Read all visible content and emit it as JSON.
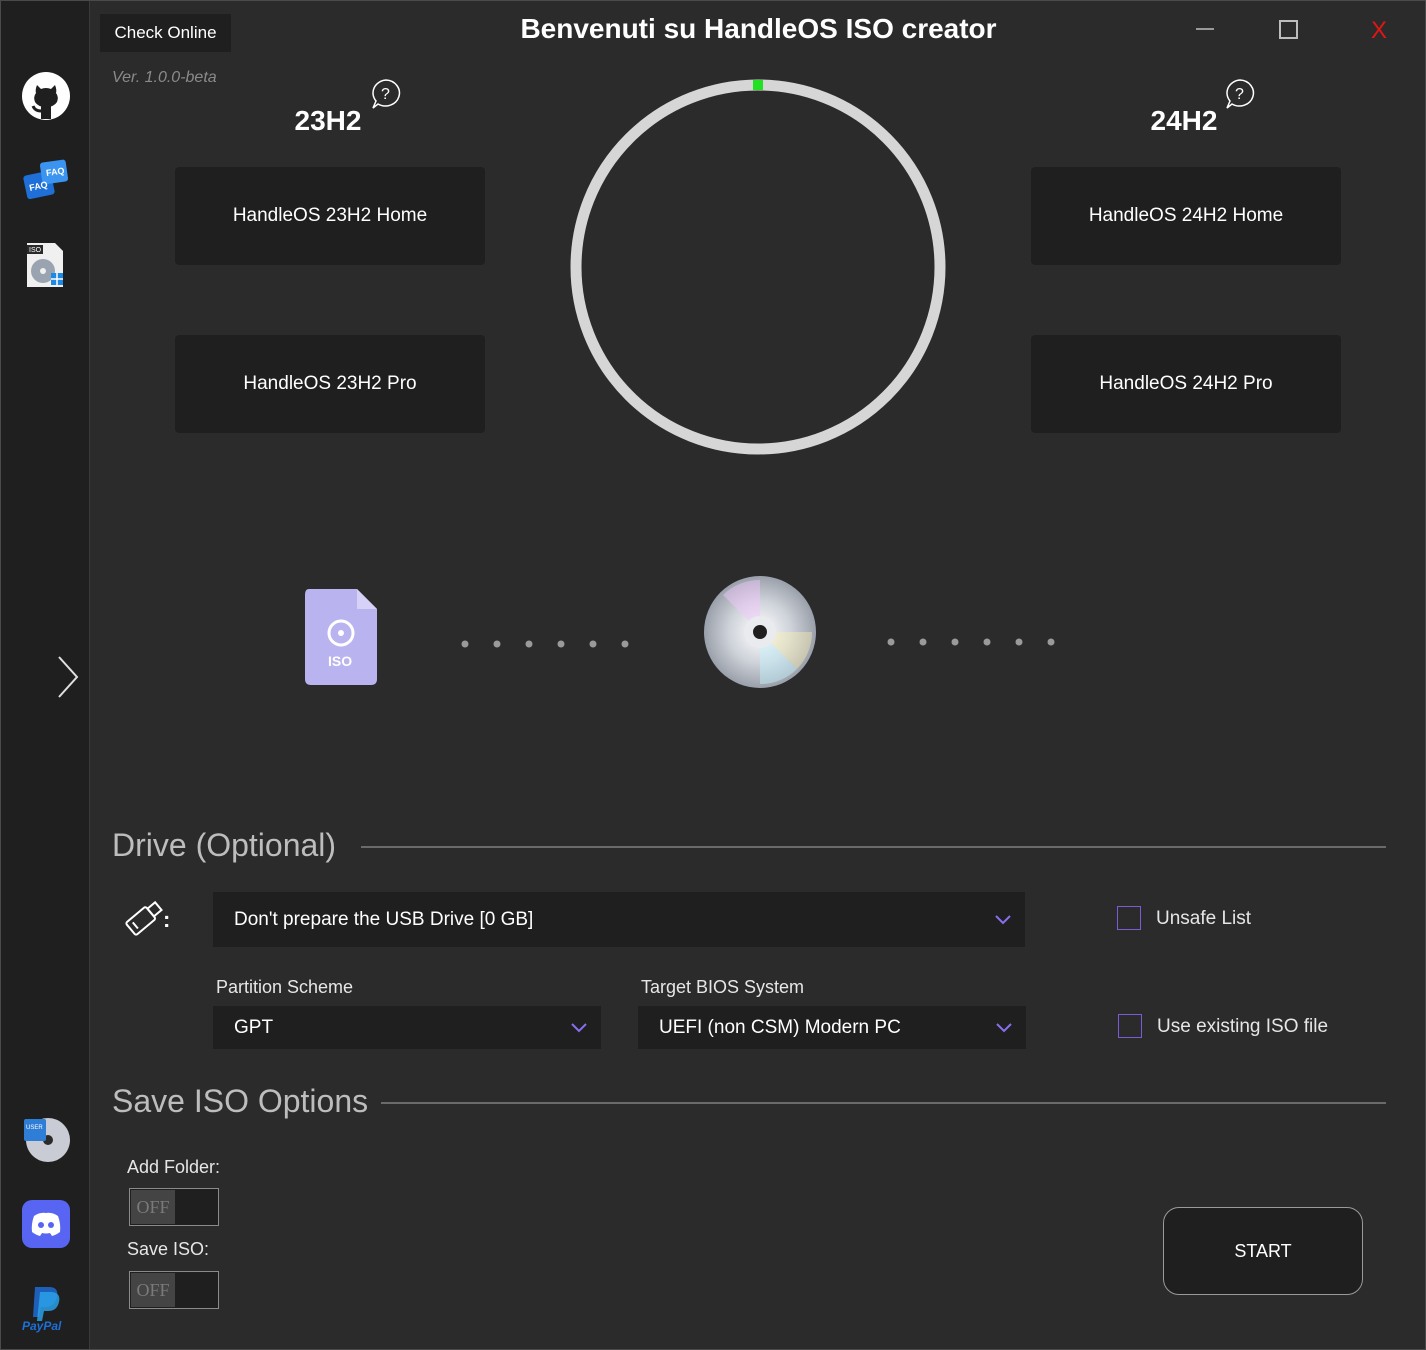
{
  "titlebar": {
    "check_online": "Check Online",
    "version": "Ver. 1.0.0-beta",
    "title": "Benvenuti su HandleOS ISO creator",
    "close_label": "X"
  },
  "sidebar": {
    "items": [
      {
        "name": "github-icon"
      },
      {
        "name": "faq-icon",
        "badge": "FAQ"
      },
      {
        "name": "iso-tool-icon",
        "badge": "ISO"
      },
      {
        "name": "expand-arrow-icon"
      },
      {
        "name": "user-disc-icon",
        "badge": "USER"
      },
      {
        "name": "discord-icon"
      },
      {
        "name": "paypal-icon",
        "badge": "PayPal"
      }
    ]
  },
  "versions": {
    "left": {
      "heading": "23H2",
      "help": "?",
      "editions": [
        "HandleOS 23H2 Home",
        "HandleOS 23H2 Pro"
      ]
    },
    "right": {
      "heading": "24H2",
      "help": "?",
      "editions": [
        "HandleOS 24H2 Home",
        "HandleOS 24H2 Pro"
      ]
    }
  },
  "progress": {
    "fraction": 0.0,
    "ring_color": "#d6d6d6",
    "marker_color": "#22e022"
  },
  "flow": {
    "iso_label": "ISO",
    "iso_color": "#b9b3f0"
  },
  "drive": {
    "heading": "Drive (Optional)",
    "usb_colon": ":",
    "usb_select": "Don't prepare the USB Drive [0 GB]",
    "partition_label": "Partition Scheme",
    "partition_value": "GPT",
    "bios_label": "Target BIOS System",
    "bios_value": "UEFI (non CSM) Modern PC",
    "unsafe_list": "Unsafe List",
    "use_existing": "Use existing ISO file"
  },
  "save": {
    "heading": "Save ISO Options",
    "add_folder_label": "Add Folder:",
    "add_folder_state": "OFF",
    "save_iso_label": "Save ISO:",
    "save_iso_state": "OFF",
    "start": "START"
  },
  "colors": {
    "background": "#2b2b2b",
    "panel": "#1f1f1f",
    "accent": "#7c5cd6",
    "close": "#e21515"
  }
}
